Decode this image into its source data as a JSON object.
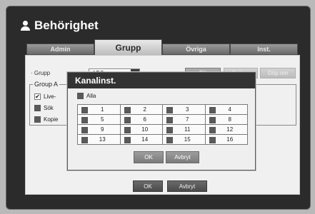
{
  "window": {
    "title": "Behörighet"
  },
  "tabs": [
    {
      "label": "Admin",
      "active": false
    },
    {
      "label": "Grupp",
      "active": true
    },
    {
      "label": "Övriga",
      "active": false
    },
    {
      "label": "Inst.",
      "active": false
    }
  ],
  "grupp": {
    "label": "· Grupp",
    "selected": "ABC",
    "buttons": {
      "add": "Till",
      "delete": "Ta bort",
      "rename": "Döp om"
    }
  },
  "group_authority": {
    "legend": "Group A",
    "items": [
      {
        "label": "Live-",
        "checked": true
      },
      {
        "label": "Sök",
        "checked": false
      },
      {
        "label": "Kopie",
        "checked": false
      }
    ]
  },
  "dialog": {
    "title": "Kanalinst.",
    "all_label": "Alla",
    "channels": [
      "1",
      "2",
      "3",
      "4",
      "5",
      "6",
      "7",
      "8",
      "9",
      "10",
      "11",
      "12",
      "13",
      "14",
      "15",
      "16"
    ],
    "ok": "OK",
    "cancel": "Avbryt"
  },
  "footer": {
    "ok": "OK",
    "cancel": "Avbryt"
  },
  "colors": {
    "window_bg": "#2b2b2b",
    "panel_bg": "#f0f0f0",
    "dialog_title_bg": "#333333"
  }
}
